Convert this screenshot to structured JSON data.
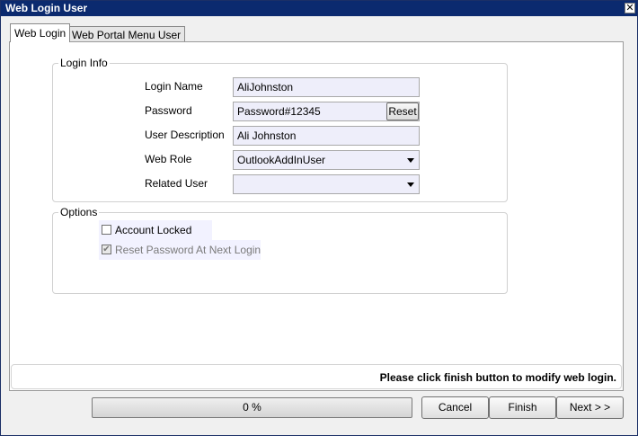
{
  "window": {
    "title": "Web Login User",
    "close_glyph": "✕"
  },
  "tabs": [
    {
      "label": "Web Login",
      "active": true
    },
    {
      "label": "Web Portal Menu User",
      "active": false
    }
  ],
  "login_info": {
    "legend": "Login Info",
    "login_name": {
      "label": "Login Name",
      "value": "AliJohnston"
    },
    "password": {
      "label": "Password",
      "value": "Password#12345",
      "reset_label": "Reset"
    },
    "user_description": {
      "label": "User Description",
      "value": "Ali Johnston"
    },
    "web_role": {
      "label": "Web Role",
      "value": "OutlookAddInUser"
    },
    "related_user": {
      "label": "Related User",
      "value": ""
    }
  },
  "options": {
    "legend": "Options",
    "account_locked": {
      "label": "Account Locked",
      "checked": false
    },
    "reset_password": {
      "label": "Reset Password At Next Login",
      "checked": true,
      "enabled": false
    }
  },
  "status": {
    "message": "Please click finish button to modify web login."
  },
  "progress": {
    "text": "0 %",
    "value": 0
  },
  "buttons": {
    "cancel": "Cancel",
    "finish": "Finish",
    "next": "Next > >"
  },
  "icons": {
    "checkmark": "✔"
  }
}
